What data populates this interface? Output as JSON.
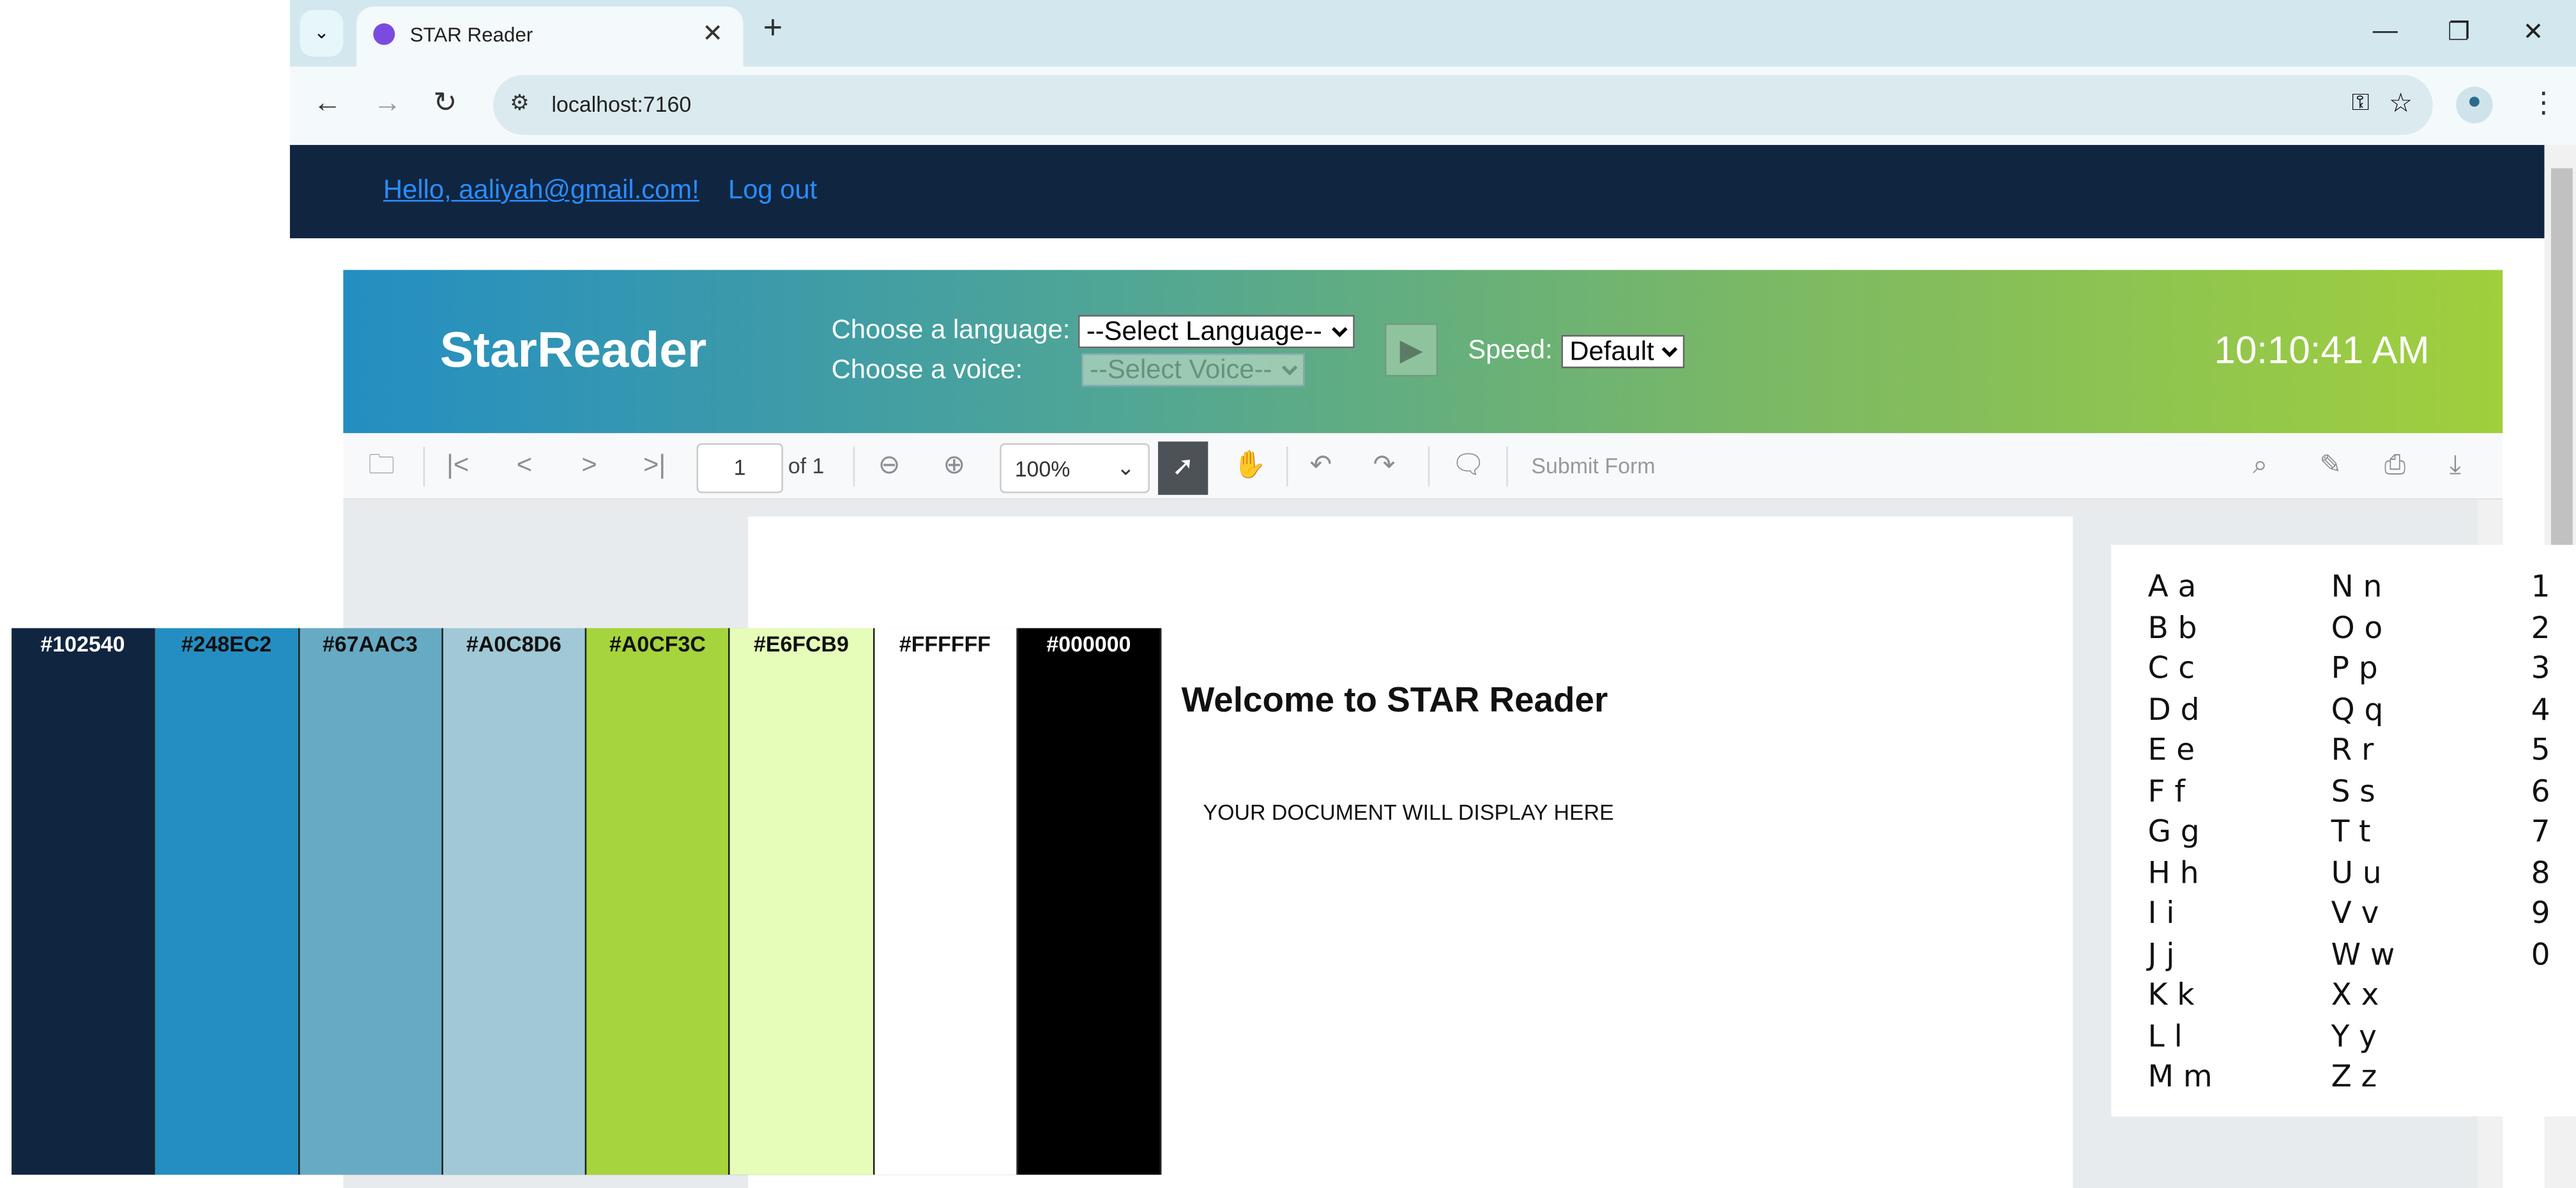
{
  "browser": {
    "tab_title": "STAR Reader",
    "url": "localhost:7160"
  },
  "nav": {
    "greeting": "Hello, aaliyah@gmail.com!",
    "logout": "Log out"
  },
  "banner": {
    "logo": "StarReader",
    "language_label": "Choose a language:",
    "language_value": "--Select Language--",
    "voice_label": "Choose a voice:",
    "voice_value": "--Select Voice--",
    "speed_label": "Speed:",
    "speed_value": "Default",
    "clock": "10:10:41 AM"
  },
  "pdf_toolbar": {
    "page": "1",
    "of": "of 1",
    "zoom": "100%",
    "submit": "Submit Form"
  },
  "document": {
    "title": "Welcome to STAR Reader",
    "body": "YOUR DOCUMENT WILL DISPLAY HERE"
  },
  "palette": [
    {
      "hex": "#102540",
      "color": "#102540",
      "text": "#ffffff"
    },
    {
      "hex": "#248EC2",
      "color": "#248EC2",
      "text": "#111111"
    },
    {
      "hex": "#67AAC3",
      "color": "#67AAC3",
      "text": "#111111"
    },
    {
      "hex": "#A0C8D6",
      "color": "#A0C8D6",
      "text": "#111111"
    },
    {
      "hex": "#A0CF3C",
      "color": "#A5D43C",
      "text": "#111111"
    },
    {
      "hex": "#E6FCB9",
      "color": "#E6FCB9",
      "text": "#111111"
    },
    {
      "hex": "#FFFFFF",
      "color": "#FFFFFF",
      "text": "#111111"
    },
    {
      "hex": "#000000",
      "color": "#000000",
      "text": "#ffffff"
    }
  ],
  "alphabet": {
    "col1": [
      "A a",
      "B b",
      "C c",
      "D d",
      "E e",
      "F f",
      "G g",
      "H h",
      "I i",
      "J j",
      "K k",
      "L l",
      "M m"
    ],
    "col2": [
      "N n",
      "O o",
      "P p",
      "Q q",
      "R r",
      "S s",
      "T t",
      "U u",
      "V v",
      "W w",
      "X x",
      "Y y",
      "Z z"
    ],
    "col3": [
      "1",
      "2",
      "3",
      "4",
      "5",
      "6",
      "7",
      "8",
      "9",
      "0"
    ]
  }
}
